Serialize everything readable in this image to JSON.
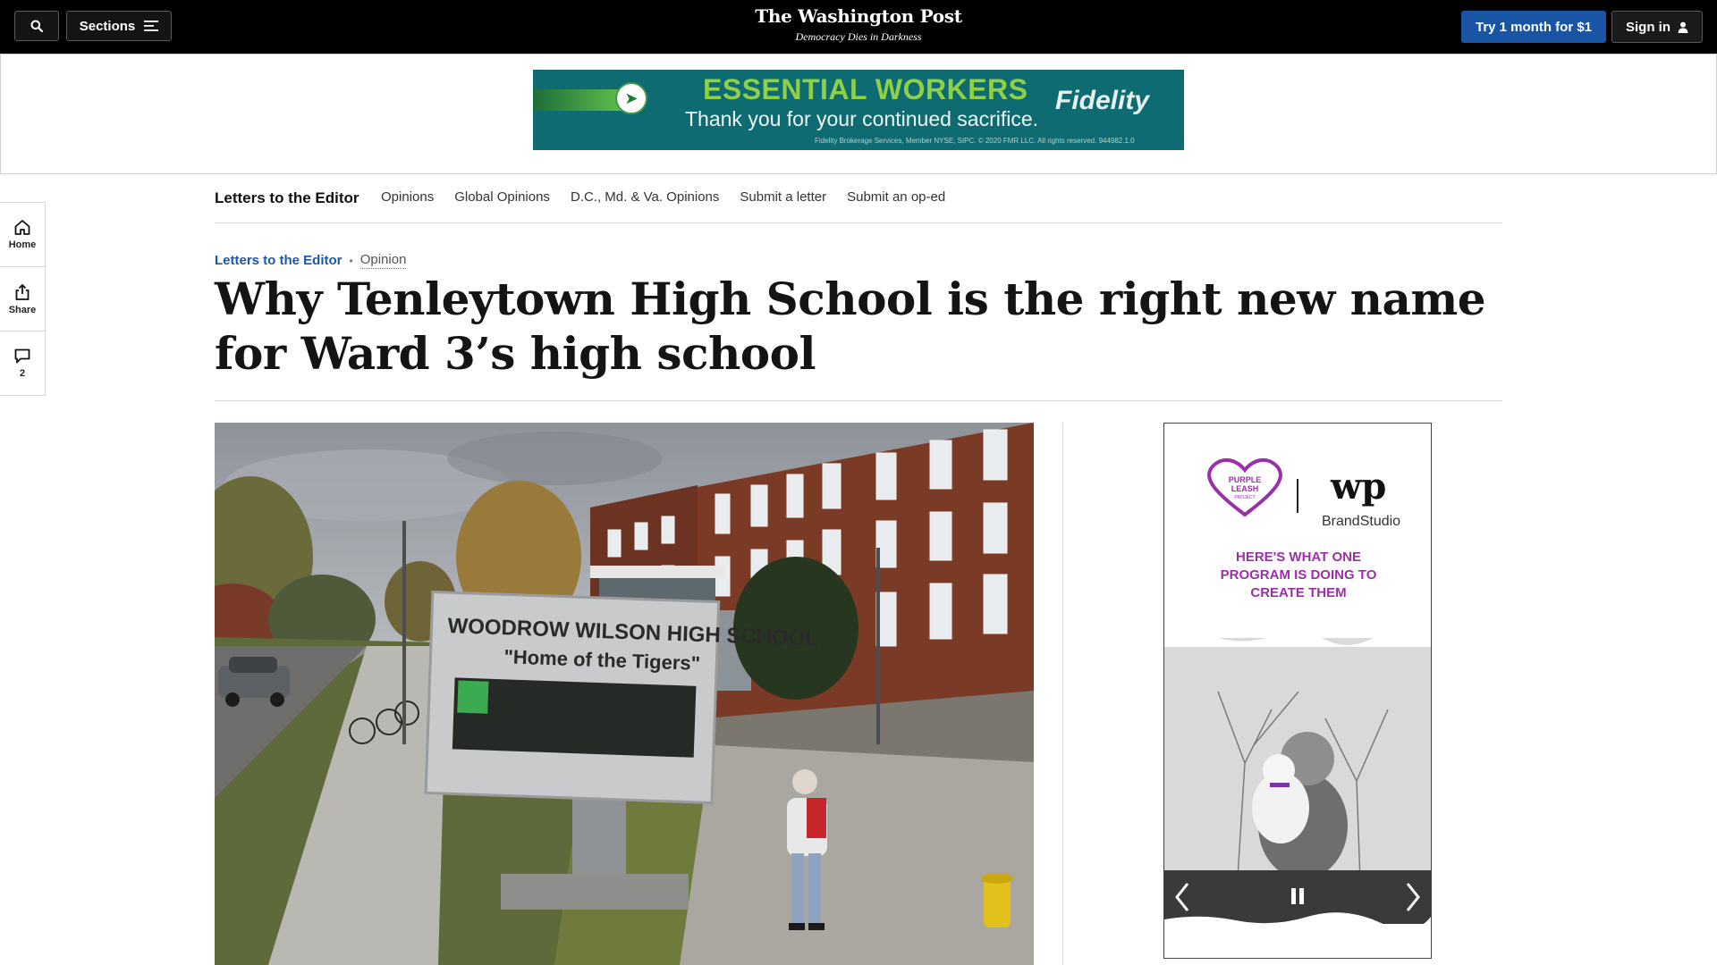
{
  "topbar": {
    "sections_label": "Sections",
    "masthead_title": "The Washington Post",
    "masthead_tagline": "Democracy Dies in Darkness",
    "trial_label": "Try 1 month for $1",
    "signin_label": "Sign in"
  },
  "top_ad": {
    "headline": "ESSENTIAL WORKERS",
    "subline": "Thank you for your continued sacrifice.",
    "brand": "Fidelity",
    "fine_print": "Fidelity Brokerage Services, Member NYSE, SIPC. © 2020 FMR LLC. All rights reserved. 944982.1.0"
  },
  "section_nav": {
    "title": "Letters to the Editor",
    "links": [
      "Opinions",
      "Global Opinions",
      "D.C., Md. & Va. Opinions",
      "Submit a letter",
      "Submit an op-ed"
    ]
  },
  "rail": {
    "home_label": "Home",
    "share_label": "Share",
    "comments_count": "2"
  },
  "article": {
    "kicker": "Letters to the Editor",
    "kicker_separator": "•",
    "kicker_secondary": "Opinion",
    "headline": "Why Tenleytown High School is the right new name for Ward 3’s high school"
  },
  "photo": {
    "sign_line1": "WOODROW WILSON HIGH SCHOOL",
    "sign_line2": "\"Home of the Tigers\""
  },
  "side_ad": {
    "partner_line1": "PURPLE",
    "partner_line2": "LEASH",
    "partner_line3": "PROJECT",
    "wp_logo": "wp",
    "brand_studio": "BrandStudio",
    "headline": "HERE'S WHAT ONE PROGRAM IS DOING TO CREATE THEM"
  },
  "colors": {
    "topbar_bg": "#000000",
    "trial_button": "#1955a5",
    "kicker_link": "#1a58a6",
    "ad_teal": "#0e6b72",
    "ad_green": "#8fd047",
    "side_ad_purple": "#9b2fa8"
  },
  "icons": [
    "search-icon",
    "menu-icon",
    "user-icon",
    "home-icon",
    "share-icon",
    "comment-icon",
    "chevron-left-icon",
    "pause-icon",
    "chevron-right-icon"
  ]
}
